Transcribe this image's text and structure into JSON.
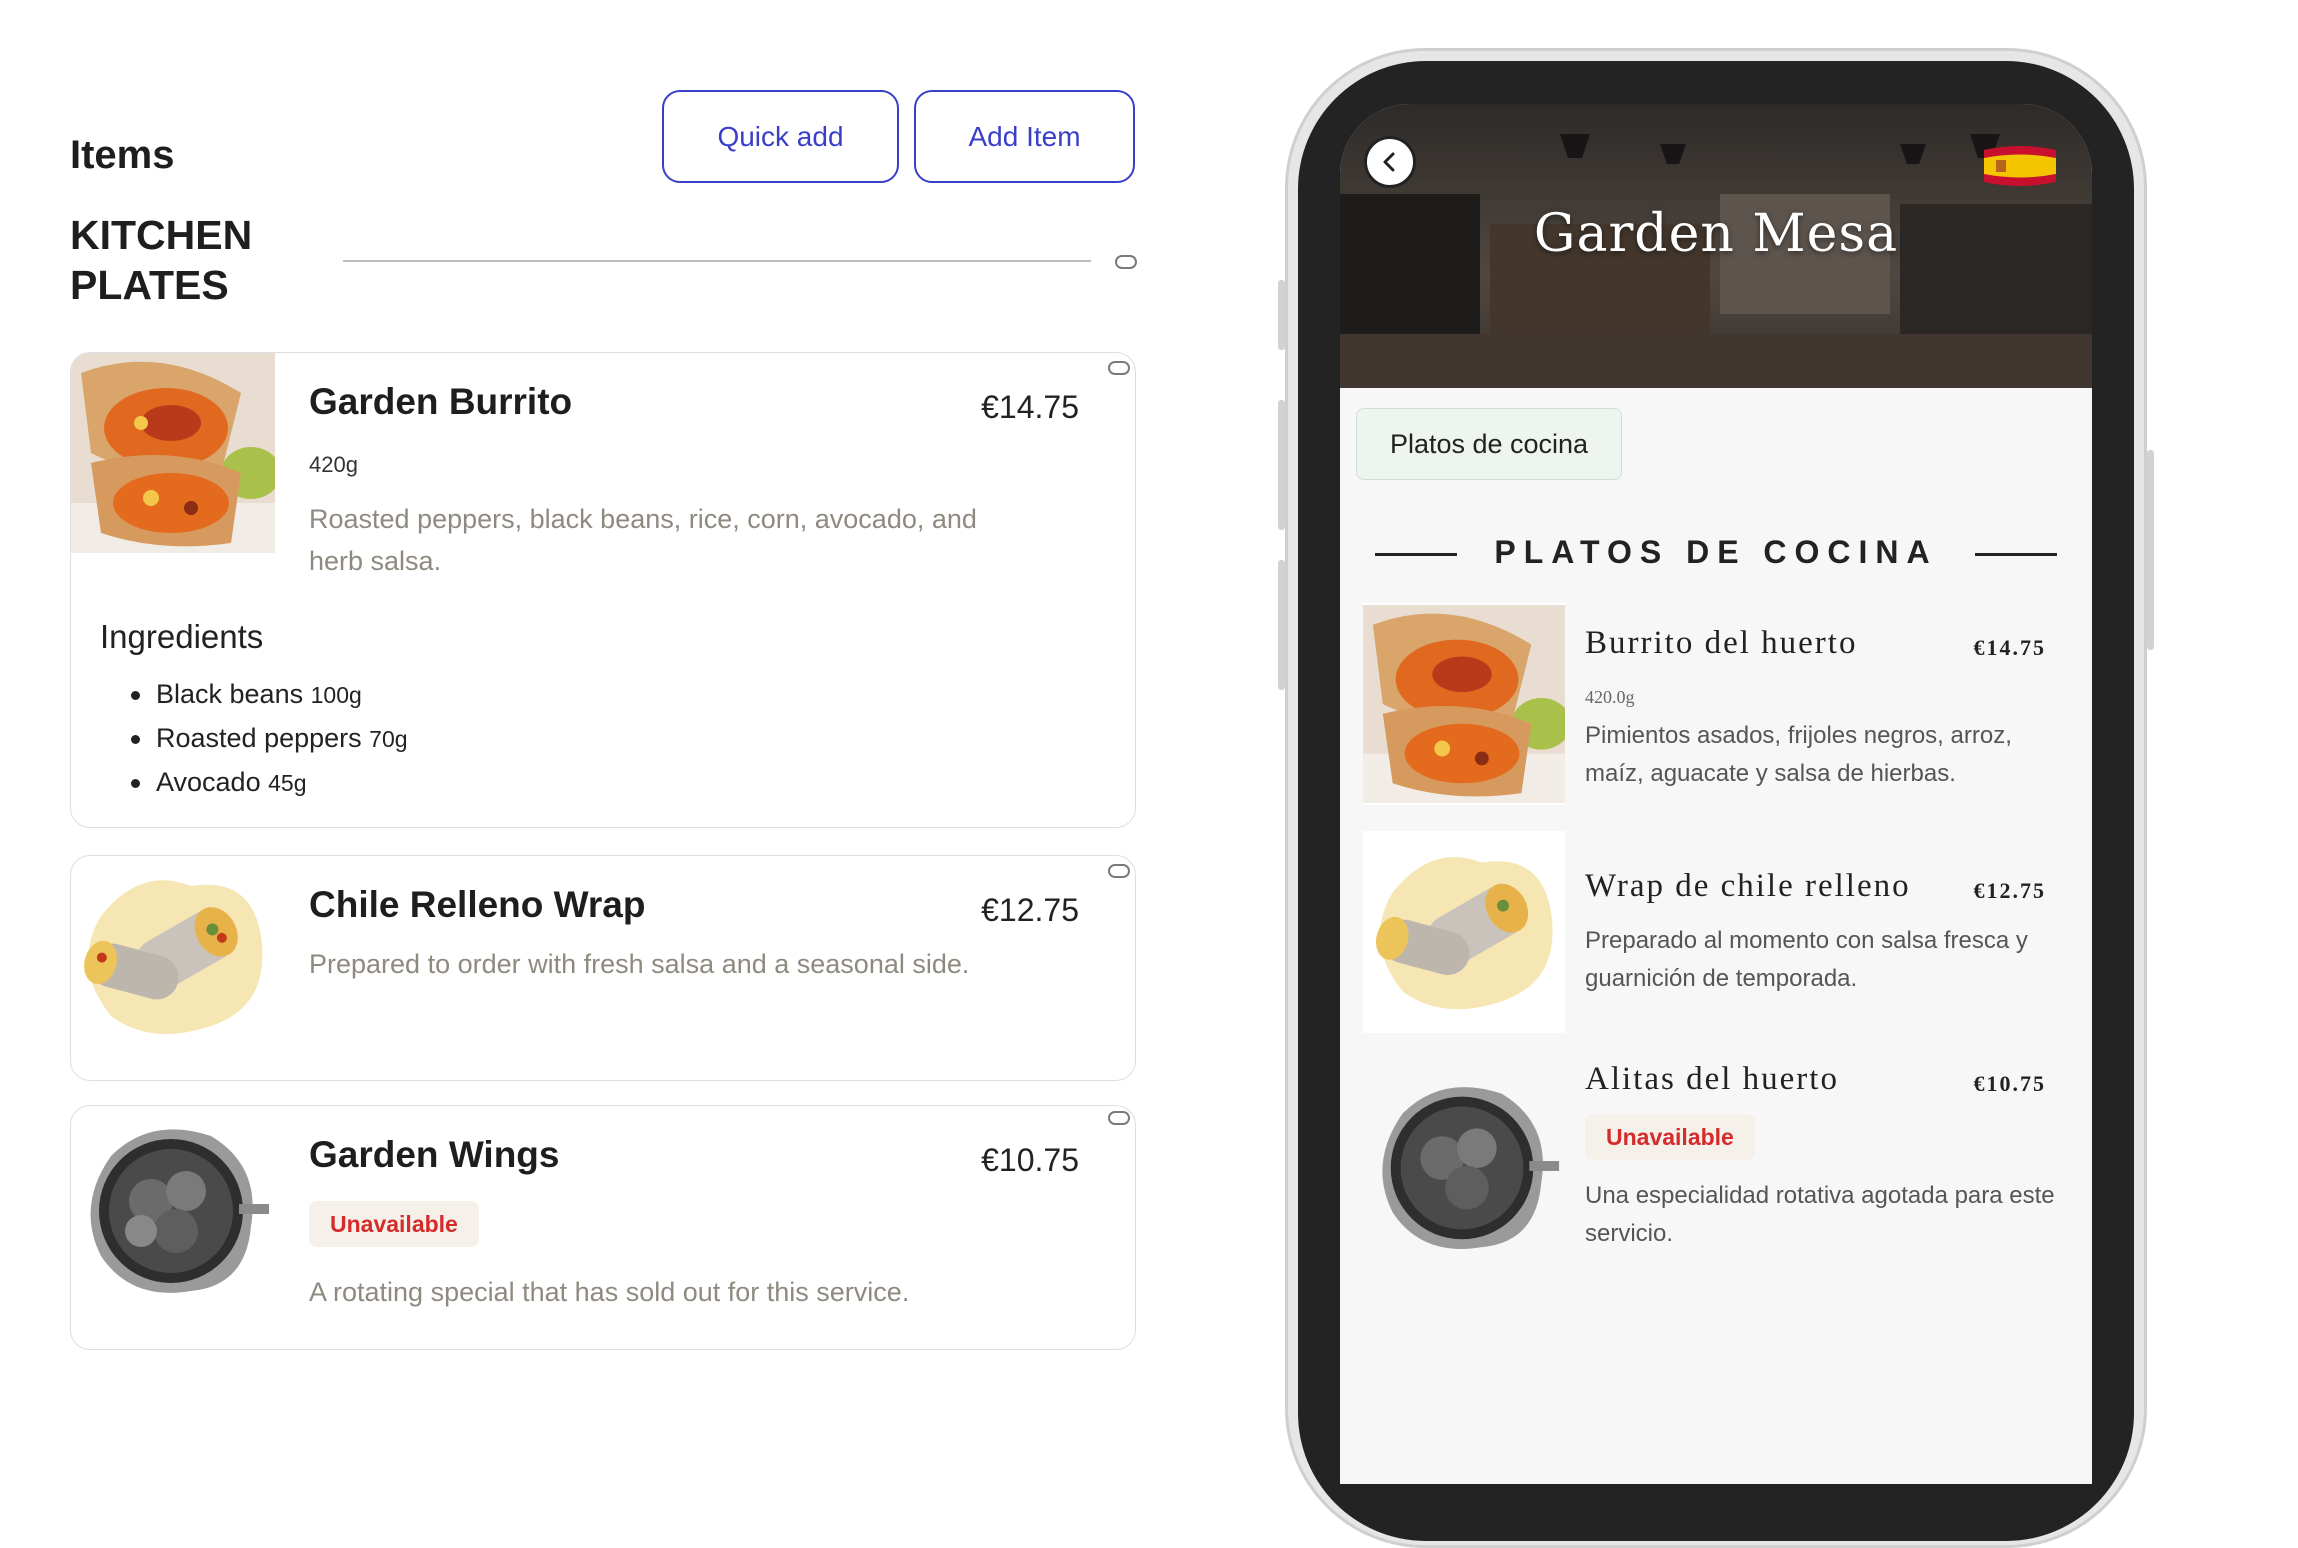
{
  "admin": {
    "title": "Items",
    "quick_add_label": "Quick add",
    "add_item_label": "Add Item",
    "section_title_line1": "KITCHEN",
    "section_title_line2": "PLATES",
    "items": [
      {
        "name": "Garden Burrito",
        "price": "€14.75",
        "weight": "420g",
        "description": "Roasted peppers, black beans, rice, corn, avocado, and herb salsa.",
        "ingredients_title": "Ingredients",
        "ingredients": [
          {
            "name": "Black beans",
            "amount": "100g"
          },
          {
            "name": "Roasted peppers",
            "amount": "70g"
          },
          {
            "name": "Avocado",
            "amount": "45g"
          }
        ]
      },
      {
        "name": "Chile Relleno Wrap",
        "price": "€12.75",
        "description": "Prepared to order with fresh salsa and a seasonal side."
      },
      {
        "name": "Garden Wings",
        "price": "€10.75",
        "badge": "Unavailable",
        "description": "A rotating special that has sold out for this service."
      }
    ]
  },
  "preview": {
    "restaurant_name": "Garden Mesa",
    "category_chip": "Platos de cocina",
    "section_heading": "PLATOS DE COCINA",
    "items": [
      {
        "name": "Burrito del huerto",
        "price": "€14.75",
        "weight": "420.0g",
        "description": "Pimientos asados, frijoles negros, arroz, maíz, aguacate y salsa de hierbas."
      },
      {
        "name": "Wrap de chile relleno",
        "price": "€12.75",
        "description": "Preparado al momento con salsa fresca y guarnición de temporada."
      },
      {
        "name": "Alitas del huerto",
        "price": "€10.75",
        "badge": "Unavailable",
        "description": "Una especialidad rotativa agotada para este servicio."
      }
    ]
  },
  "icons": {
    "back": "chevron-left-icon",
    "flag": "spain-flag-icon",
    "toggle": "toggle-pill-icon"
  },
  "colors": {
    "accent": "#3a3fc9",
    "unavailable": "#d42b2b",
    "muted_text": "#8f8a80",
    "chip_bg": "#eef5ef"
  }
}
